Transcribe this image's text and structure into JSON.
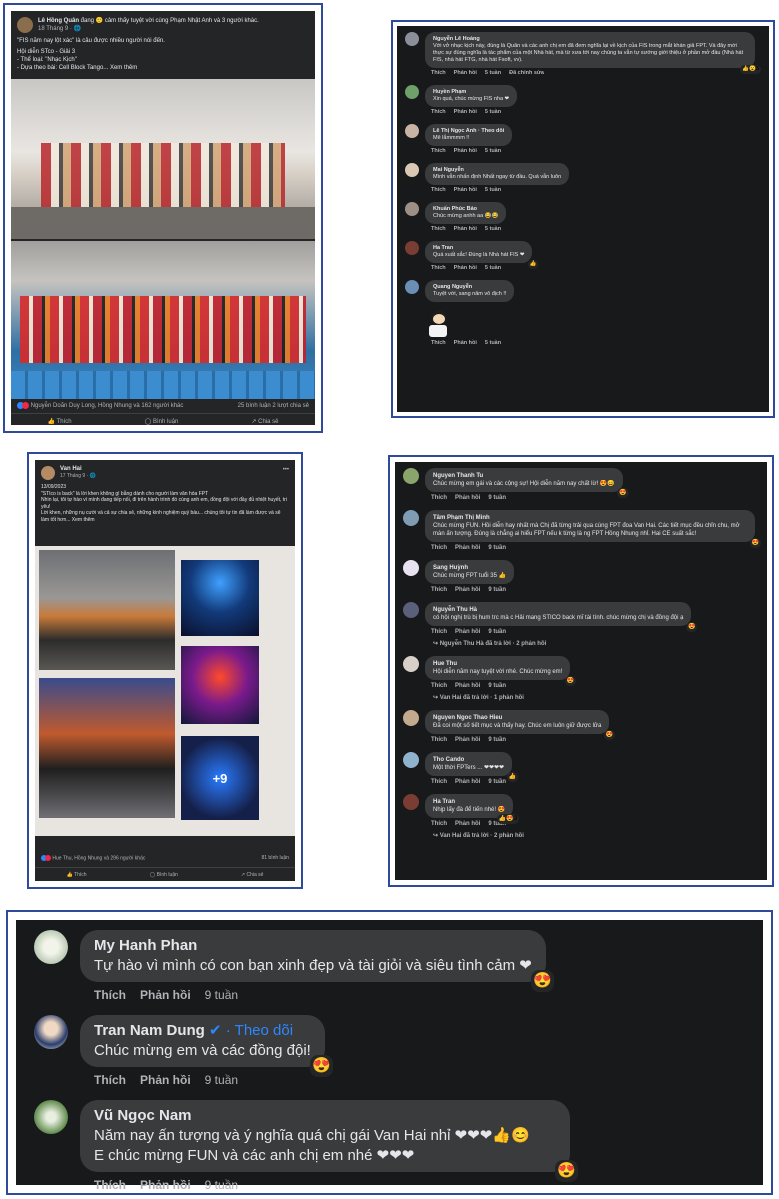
{
  "colors": {
    "frame": "#2f4a9a",
    "bg_dark": "#18191a",
    "bubble": "#3a3b3c",
    "text": "#e4e6eb",
    "muted": "#b0b3b8",
    "link": "#2d88ff",
    "heart": "#f02849"
  },
  "post1": {
    "author": "Lê Hồng Quân",
    "header_text": "đang 🙂 cảm thấy tuyệt vời cùng Phạm Nhật Anh và 3 người khác.",
    "time": "18 Tháng 9 · 🌐",
    "body": [
      "\"FIS năm nay lột xác\" là câu được nhiều người nói đến.",
      "Hội diễn STco - Giải 3",
      "- Thể loại: \"Nhạc Kịch\"",
      "- Dựa theo bài: Cell Block Tango... Xem thêm"
    ],
    "reactions": "Nguyễn Doãn Duy Long, Hồng Nhung và 162 người khác",
    "stats_right": "25 bình luận   2 lượt chia sẻ",
    "actions": [
      "Thích",
      "Bình luận",
      "Chia sẻ"
    ]
  },
  "panel2": {
    "comments": [
      {
        "name": "Nguyễn Lê Hoàng",
        "text": "Với vở nhạc kịch này, đúng là Quân và các anh chị em đã đem nghĩa lại về kịch của FIS trong mắt khán giả FPT. Và đây mới thực sự đúng nghĩa là tác phẩm của một Nhà hát, mà từ xưa tới nay chúng ta vẫn tự sướng giới thiệu ở phần mở đầu (Nhà hát FIS, nhà hát FTG, nhà hát Fsoft, vv).",
        "meta": [
          "Thích",
          "Phản hồi",
          "5 tuần",
          "Đã chỉnh sửa"
        ],
        "rx": "👍😮3"
      },
      {
        "name": "Huyền Phạm",
        "text": "Xin quá, chúc mừng FIS nha ❤",
        "meta": [
          "Thích",
          "Phản hồi",
          "5 tuần"
        ],
        "rx": ""
      },
      {
        "name": "Lê Thị Ngọc Anh · Theo dõi",
        "text": "Mê lắmmmm !!",
        "meta": [
          "Thích",
          "Phản hồi",
          "5 tuần"
        ],
        "rx": ""
      },
      {
        "name": "Mai Nguyễn",
        "text": "Mình vẫn nhấn định Nhất ngay từ đầu. Quá vẫn luôn",
        "meta": [
          "Thích",
          "Phản hồi",
          "5 tuần"
        ],
        "rx": ""
      },
      {
        "name": "Khuấn Phúc Bảo",
        "text": "Chúc mừng anhh aa 😂😂",
        "meta": [
          "Thích",
          "Phản hồi",
          "5 tuần"
        ],
        "rx": ""
      },
      {
        "name": "Ha Tran",
        "text": "Quá xuất sắc! Đúng là Nhà hát FIS ❤",
        "meta": [
          "Thích",
          "Phản hồi",
          "5 tuần"
        ],
        "rx": "👍"
      },
      {
        "name": "Quang Nguyễn",
        "text": "Tuyệt vời, sang năm vô địch !!",
        "meta": [
          "Thích",
          "Phản hồi",
          "5 tuần"
        ],
        "rx": ""
      }
    ],
    "sticker_meta": [
      "Thích",
      "Phản hồi",
      "5 tuần"
    ]
  },
  "post3": {
    "author": "Van Hai",
    "time": "17 Tháng 9 · 🌐",
    "body": [
      "13/09/2023",
      "\"STIco is back\" là lời khen không gì bằng dành cho người làm văn hóa FPT",
      "Nhìn lại, tôi tự hào vì mình đang tiếp nối, đi trên hành trình đó cùng anh em, đồng đội với đầy đủ nhiệt huyết, tri yêu!",
      "Lời khen, những nụ cười và cả sự chia sẻ, những kinh nghiệm quý báu... chúng tôi tự tin đã làm được và sẽ làm tốt hơn... Xem thêm"
    ],
    "more_photos": "+9",
    "reactions": "Hue Thu, Hồng Nhung và 296 người khác",
    "stats_right": "81 bình luận",
    "actions": [
      "Thích",
      "Bình luận",
      "Chia sẻ"
    ]
  },
  "panel4": {
    "comments": [
      {
        "name": "Nguyen Thanh Tu",
        "text": "Chúc mừng em gái và các cộng sự! Hội diễn năm nay chất lừ! 😍😄",
        "meta": [
          "Thích",
          "Phản hồi",
          "9 tuần"
        ],
        "rx": "😍",
        "reply": ""
      },
      {
        "name": "Tâm Phạm Thị Minh",
        "text": "Chúc mừng FUN. Hồi diễn hay nhất mà Chị đã từng trải qua cùng FPT đoa Van Hai. Các tiết mục đều chỉn chu, mở màn ấn tượng. Đúng là chẳng ai hiểu FPT nếu k từng là ng FPT Hồng Nhung nhỉ. Hai CE suất sắc!",
        "meta": [
          "Thích",
          "Phản hồi",
          "9 tuần"
        ],
        "rx": "😍",
        "reply": ""
      },
      {
        "name": "Sang Huỳnh",
        "text": "Chúc mừng FPT tuổi 35 👍",
        "meta": [
          "Thích",
          "Phản hồi",
          "9 tuần"
        ],
        "rx": "",
        "reply": ""
      },
      {
        "name": "Nguyễn Thu Hà",
        "text": "có hội nghị trù bị hum trc mà c Hải mang STICO back mĩ tài tình. chúc mừng chị và đồng đội ạ",
        "meta": [
          "Thích",
          "Phản hồi",
          "9 tuần"
        ],
        "rx": "😍",
        "reply": "↪ Nguyễn Thu Hà đã trả lời · 2 phản hồi"
      },
      {
        "name": "Hue Thu",
        "text": "Hội diễn năm nay tuyệt vời nhé. Chúc mừng em!",
        "meta": [
          "Thích",
          "Phản hồi",
          "9 tuần"
        ],
        "rx": "😍",
        "reply": "↪ Van Hai đã trả lời · 1 phản hồi"
      },
      {
        "name": "Nguyen Ngoc Thao Hieu",
        "text": "Đã coi một số tiết mục và thấy hay. Chúc em luôn giữ được lửa",
        "meta": [
          "Thích",
          "Phản hồi",
          "9 tuần"
        ],
        "rx": "😍",
        "reply": ""
      },
      {
        "name": "Tho Cando",
        "text": "Một thời FPTers ... ❤❤❤❤",
        "meta": [
          "Thích",
          "Phản hồi",
          "9 tuần"
        ],
        "rx": "👍",
        "reply": ""
      },
      {
        "name": "Ha Tran",
        "text": "Nhịp lấy đà để tiến nhé! 😍",
        "meta": [
          "Thích",
          "Phản hồi",
          "9 tuần"
        ],
        "rx": "👍😍3",
        "reply": "↪ Van Hai đã trả lời · 2 phản hồi"
      }
    ]
  },
  "panel5": {
    "comments": [
      {
        "name": "My Hanh Phan",
        "text": "Tự hào vì mình có con bạn xinh đẹp và tài giỏi và siêu tình cảm ❤",
        "meta": [
          "Thích",
          "Phản hồi",
          "9 tuần"
        ],
        "follow": ""
      },
      {
        "name": "Tran Nam Dung",
        "text": "Chúc mừng em và các đồng đội!",
        "meta": [
          "Thích",
          "Phản hồi",
          "9 tuần"
        ],
        "follow": " ✔ · Theo dõi"
      },
      {
        "name": "Vũ Ngọc Nam",
        "text": "Năm nay ấn tượng và ý nghĩa quá chị gái Van Hai nhỉ ❤❤❤👍😊",
        "text2": "E chúc mừng FUN và các anh chị em nhé ❤❤❤",
        "meta": [
          "Thích",
          "Phản hồi",
          "9 tuần"
        ],
        "follow": ""
      }
    ]
  }
}
